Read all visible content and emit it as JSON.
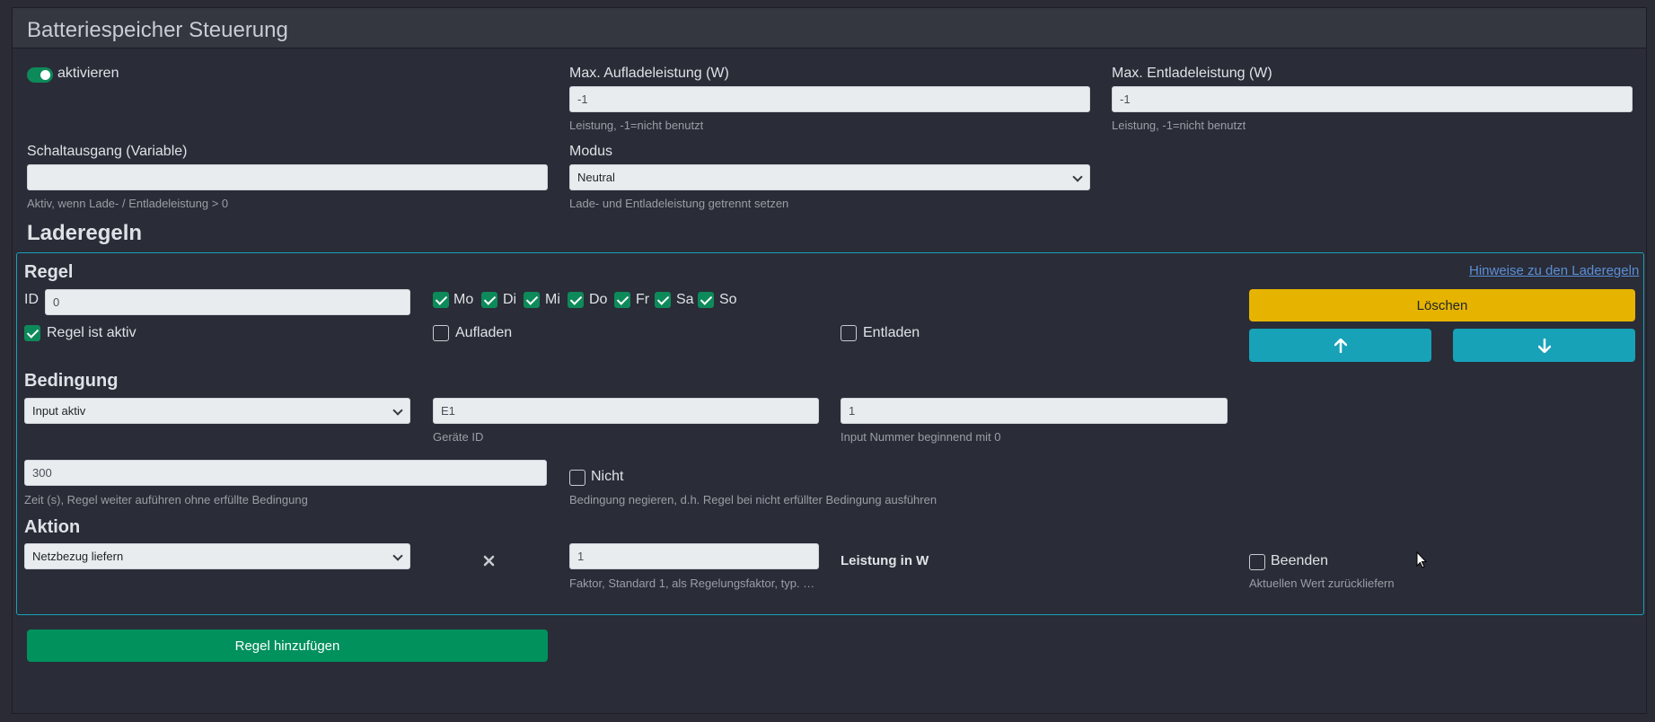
{
  "header": {
    "title": "Batteriespeicher Steuerung"
  },
  "settings": {
    "activate_label": "aktivieren",
    "max_charge": {
      "label": "Max. Aufladeleistung (W)",
      "value": "-1",
      "help": "Leistung, -1=nicht benutzt"
    },
    "max_discharge": {
      "label": "Max. Entladeleistung (W)",
      "value": "-1",
      "help": "Leistung, -1=nicht benutzt"
    },
    "switch_output": {
      "label": "Schaltausgang (Variable)",
      "value": "",
      "help": "Aktiv, wenn Lade- / Entladeleistung > 0"
    },
    "mode": {
      "label": "Modus",
      "value": "Neutral",
      "help": "Lade- und Entladeleistung getrennt setzen"
    }
  },
  "rules_section": {
    "title": "Laderegeln"
  },
  "rule": {
    "title": "Regel",
    "hint_link": "Hinweise zu den Laderegeln",
    "id_label": "ID",
    "id_value": "0",
    "days": [
      {
        "label": "Mo",
        "checked": true
      },
      {
        "label": "Di",
        "checked": true
      },
      {
        "label": "Mi",
        "checked": true
      },
      {
        "label": "Do",
        "checked": true
      },
      {
        "label": "Fr",
        "checked": true
      },
      {
        "label": "Sa",
        "checked": true
      },
      {
        "label": "So",
        "checked": true
      }
    ],
    "active_label": "Regel ist aktiv",
    "charge_label": "Aufladen",
    "discharge_label": "Entladen",
    "delete_label": "Löschen",
    "up_icon": "arrow-up-icon",
    "down_icon": "arrow-down-icon"
  },
  "condition": {
    "title": "Bedingung",
    "type_value": "Input aktiv",
    "device_id_value": "E1",
    "device_id_help": "Geräte ID",
    "input_number_value": "1",
    "input_number_help": "Input Nummer beginnend mit 0",
    "time_value": "300",
    "time_help": "Zeit (s), Regel weiter auführen ohne erfüllte Bedingung",
    "not_label": "Nicht",
    "not_help": "Bedingung negieren, d.h. Regel bei nicht erfüllter Bedingung ausführen"
  },
  "action": {
    "title": "Aktion",
    "type_value": "Netzbezug liefern",
    "multiply_icon": "times-icon",
    "factor_value": "1",
    "factor_help": "Faktor, Standard 1, als Regelungsfaktor, typ. n...",
    "unit_label": "Leistung in W",
    "end_label": "Beenden",
    "end_help": "Aktuellen Wert zurückliefern"
  },
  "add_rule_label": "Regel hinzufügen",
  "colors": {
    "accent_green": "#0d8a5a",
    "warning": "#e6b400",
    "info": "#17a2b8",
    "success": "#00915d"
  }
}
